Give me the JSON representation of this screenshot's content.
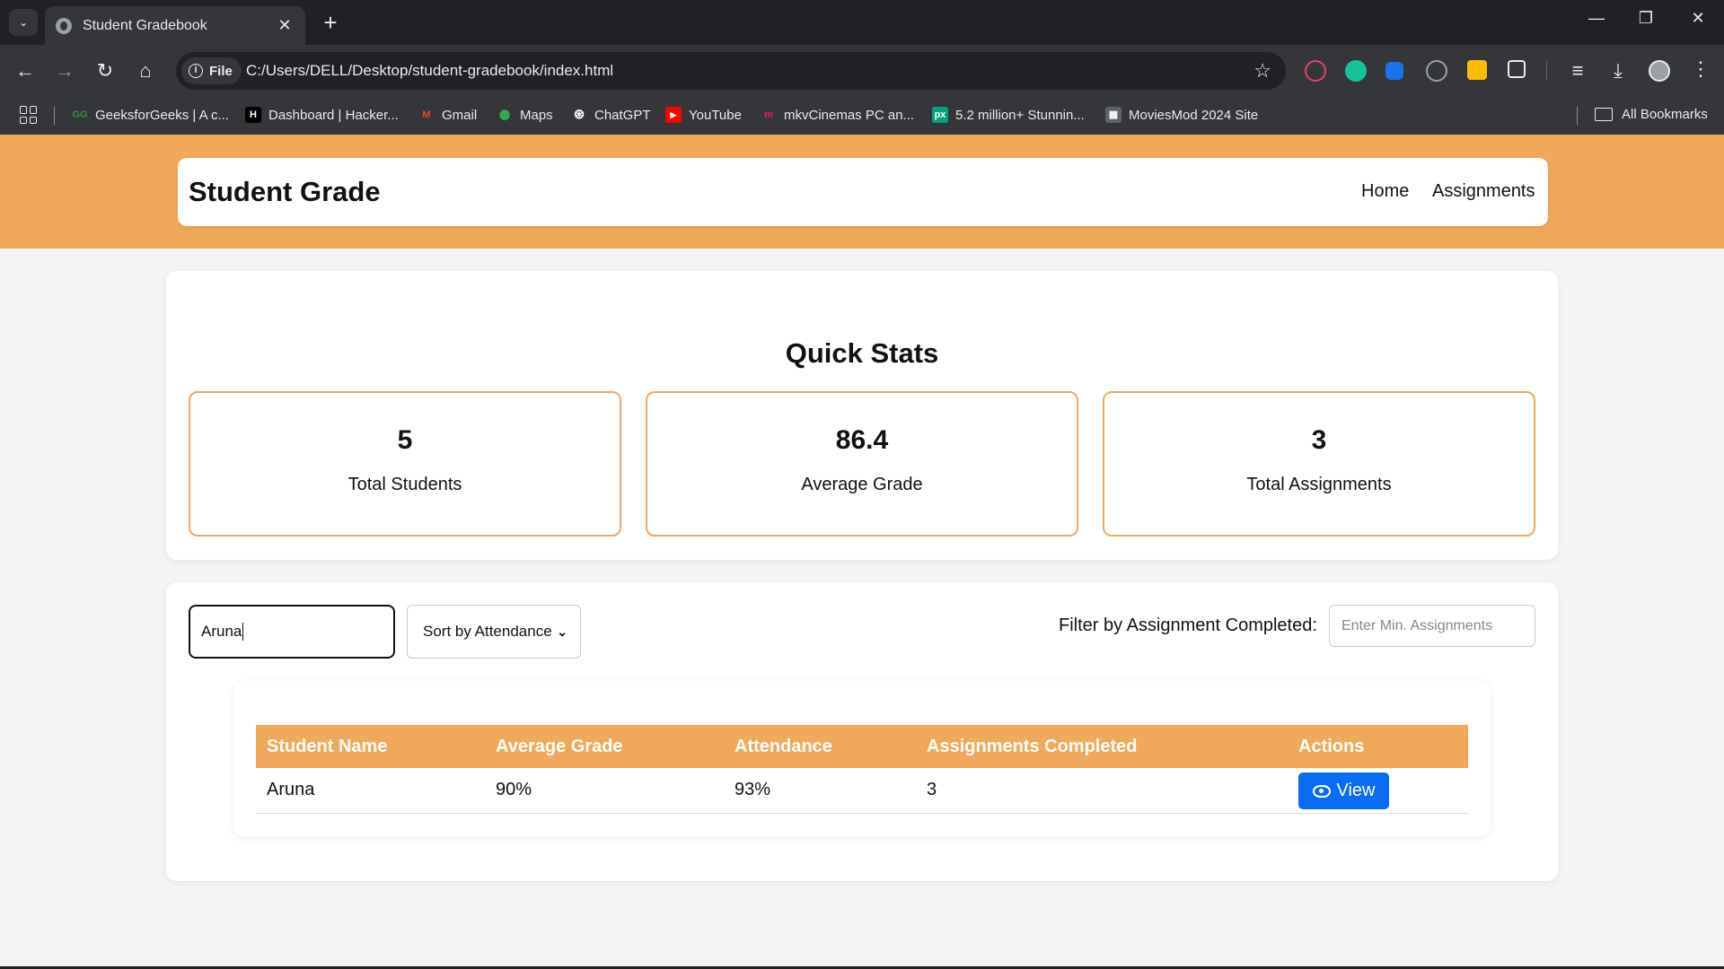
{
  "browser": {
    "tab_title": "Student Gradebook",
    "tab_close": "✕",
    "new_tab": "+",
    "file_chip": "File",
    "url": "C:/Users/DELL/Desktop/student-gradebook/index.html",
    "window_controls": [
      "—",
      "❐",
      "✕"
    ],
    "bookmarks": [
      {
        "label": "GeeksforGeeks | A c...",
        "icon": "geeksforgeeks-icon",
        "color": "#2f8d46"
      },
      {
        "label": "Dashboard | Hacker...",
        "icon": "hackerrank-icon",
        "color": "#000000"
      },
      {
        "label": "Gmail",
        "icon": "gmail-icon",
        "color": "#ea4335"
      },
      {
        "label": "Maps",
        "icon": "maps-icon",
        "color": "#34a853"
      },
      {
        "label": "ChatGPT",
        "icon": "chatgpt-icon",
        "color": "#ffffff"
      },
      {
        "label": "YouTube",
        "icon": "youtube-icon",
        "color": "#ff0000"
      },
      {
        "label": "mkvCinemas PC an...",
        "icon": "mkvcinemas-icon",
        "color": "#e91e63"
      },
      {
        "label": "5.2 million+ Stunnin...",
        "icon": "pexels-icon",
        "color": "#05a081"
      },
      {
        "label": "MoviesMod 2024 Site",
        "icon": "moviesmod-icon",
        "color": "#5f6368"
      }
    ],
    "all_bookmarks": "All Bookmarks"
  },
  "navbar": {
    "brand": "Student Grade",
    "links": [
      "Home",
      "Assignments"
    ]
  },
  "stats": {
    "title": "Quick Stats",
    "items": [
      {
        "value": "5",
        "label": "Total Students"
      },
      {
        "value": "86.4",
        "label": "Average Grade"
      },
      {
        "value": "3",
        "label": "Total Assignments"
      }
    ]
  },
  "controls": {
    "search_value": "Aruna",
    "sort_selected": "Sort by Attendance",
    "filter_label": "Filter by Assignment Completed:",
    "filter_placeholder": "Enter Min. Assignments"
  },
  "table": {
    "headers": [
      "Student Name",
      "Average Grade",
      "Attendance",
      "Assignments Completed",
      "Actions"
    ],
    "rows": [
      {
        "name": "Aruna",
        "grade": "90%",
        "attendance": "93%",
        "assignments": "3",
        "action": "View"
      }
    ]
  },
  "colors": {
    "accent": "#f0a95a",
    "primary_button": "#0a6cf5"
  }
}
